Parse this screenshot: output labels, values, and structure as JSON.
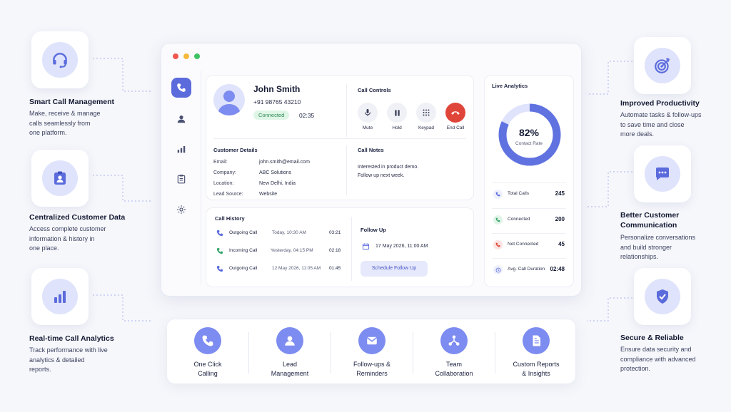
{
  "features_left": [
    {
      "title": "Smart Call Management",
      "desc": "Make, receive & manage\ncalls seamlessly from\none platform.",
      "icon": "headset-icon"
    },
    {
      "title": "Centralized Customer Data",
      "desc": "Access complete customer\ninformation & history in\none place.",
      "icon": "contact-card-icon"
    },
    {
      "title": "Real-time Call Analytics",
      "desc": "Track performance with live\nanalytics & detailed\nreports.",
      "icon": "bar-chart-icon"
    }
  ],
  "features_right": [
    {
      "title": "Improved Productivity",
      "desc": "Automate tasks & follow-ups\nto save time and close\nmore deals.",
      "icon": "target-icon"
    },
    {
      "title": "Better Customer\nCommunication",
      "desc": "Personalize conversations\nand build stronger\nrelationships.",
      "icon": "chat-icon"
    },
    {
      "title": "Secure & Reliable",
      "desc": "Ensure data security and\ncompliance with advanced\nprotection.",
      "icon": "shield-check-icon"
    }
  ],
  "contact": {
    "name": "John Smith",
    "phone": "+91 98765 43210",
    "status": "Connected",
    "timer": "02:35"
  },
  "call_controls": {
    "title": "Call Controls",
    "buttons": [
      {
        "label": "Mute",
        "icon": "mic-icon"
      },
      {
        "label": "Hold",
        "icon": "pause-icon"
      },
      {
        "label": "Keypad",
        "icon": "keypad-icon"
      },
      {
        "label": "End Call",
        "icon": "end-call-icon"
      }
    ]
  },
  "customer_details": {
    "title": "Customer Details",
    "rows": [
      {
        "label": "Email:",
        "value": "john.smith@email.com"
      },
      {
        "label": "Company:",
        "value": "ABC Solutions"
      },
      {
        "label": "Location:",
        "value": "New Delhi, India"
      },
      {
        "label": "Lead Source:",
        "value": "Website"
      }
    ]
  },
  "call_notes": {
    "title": "Call Notes",
    "text": "Interested in product demo.\nFollow up next week."
  },
  "call_history": {
    "title": "Call History",
    "rows": [
      {
        "type": "Outgoing Call",
        "date": "Today, 10:30 AM",
        "duration": "03:21",
        "icon": "outgoing-call-icon"
      },
      {
        "type": "Incoming Call",
        "date": "Yesterday, 04:15 PM",
        "duration": "02:18",
        "icon": "incoming-call-icon"
      },
      {
        "type": "Outgoing Call",
        "date": "12 May 2026, 11:05 AM",
        "duration": "01:45",
        "icon": "outgoing-call-icon"
      }
    ]
  },
  "follow_up": {
    "title": "Follow Up",
    "date": "17 May 2026, 11:00 AM",
    "button": "Schedule Follow Up"
  },
  "live_analytics": {
    "title": "Live Analytics",
    "percent_label": "82%",
    "percent_value": 82,
    "sub": "Contact Rate",
    "stats": [
      {
        "label": "Total Calls",
        "value": "245",
        "color": "#5b6bdc"
      },
      {
        "label": "Connected",
        "value": "200",
        "color": "#3aa66b"
      },
      {
        "label": "Not Connected",
        "value": "45",
        "color": "#e0453a"
      },
      {
        "label": "Avg. Call Duration",
        "value": "02:48",
        "color": "#5b6bdc"
      }
    ]
  },
  "bottom_features": [
    {
      "label": "One Click\nCalling",
      "icon": "phone-icon"
    },
    {
      "label": "Lead\nManagement",
      "icon": "user-icon"
    },
    {
      "label": "Follow-ups &\nReminders",
      "icon": "mail-icon"
    },
    {
      "label": "Team\nCollaboration",
      "icon": "network-icon"
    },
    {
      "label": "Custom Reports\n& Insights",
      "icon": "document-icon"
    }
  ],
  "colors": {
    "accent": "#5b6bdc",
    "accent_light": "#dfe3fb",
    "connected_bg": "#dff5e6",
    "connected_text": "#2e8a55",
    "end_call": "#e0453a"
  }
}
